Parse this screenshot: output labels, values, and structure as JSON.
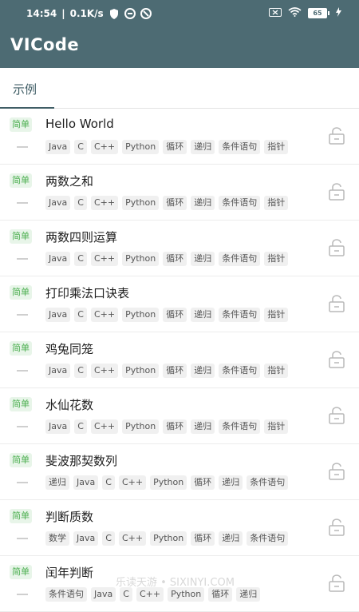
{
  "status_bar": {
    "time": "14:54",
    "speed": "0.1K/s",
    "battery": "65"
  },
  "app_title": "VICode",
  "tabs": [
    {
      "label": "示例"
    }
  ],
  "items": [
    {
      "badge": "简单",
      "title": "Hello World",
      "tags": [
        "Java",
        "C",
        "C++",
        "Python",
        "循环",
        "递归",
        "条件语句",
        "指针"
      ]
    },
    {
      "badge": "简单",
      "title": "两数之和",
      "tags": [
        "Java",
        "C",
        "C++",
        "Python",
        "循环",
        "递归",
        "条件语句",
        "指针"
      ]
    },
    {
      "badge": "简单",
      "title": "两数四则运算",
      "tags": [
        "Java",
        "C",
        "C++",
        "Python",
        "循环",
        "递归",
        "条件语句",
        "指针"
      ]
    },
    {
      "badge": "简单",
      "title": "打印乘法口诀表",
      "tags": [
        "Java",
        "C",
        "C++",
        "Python",
        "循环",
        "递归",
        "条件语句",
        "指针"
      ]
    },
    {
      "badge": "简单",
      "title": "鸡兔同笼",
      "tags": [
        "Java",
        "C",
        "C++",
        "Python",
        "循环",
        "递归",
        "条件语句",
        "指针"
      ]
    },
    {
      "badge": "简单",
      "title": "水仙花数",
      "tags": [
        "Java",
        "C",
        "C++",
        "Python",
        "循环",
        "递归",
        "条件语句",
        "指针"
      ]
    },
    {
      "badge": "简单",
      "title": "斐波那契数列",
      "tags": [
        "递归",
        "Java",
        "C",
        "C++",
        "Python",
        "循环",
        "递归",
        "条件语句"
      ]
    },
    {
      "badge": "简单",
      "title": "判断质数",
      "tags": [
        "数学",
        "Java",
        "C",
        "C++",
        "Python",
        "循环",
        "递归",
        "条件语句"
      ]
    },
    {
      "badge": "简单",
      "title": "闰年判断",
      "tags": [
        "条件语句",
        "Java",
        "C",
        "C++",
        "Python",
        "循环",
        "递归"
      ]
    }
  ],
  "watermark": "乐读天游 • SIXINYI.COM",
  "icons": {
    "lock": "unlock-icon"
  }
}
